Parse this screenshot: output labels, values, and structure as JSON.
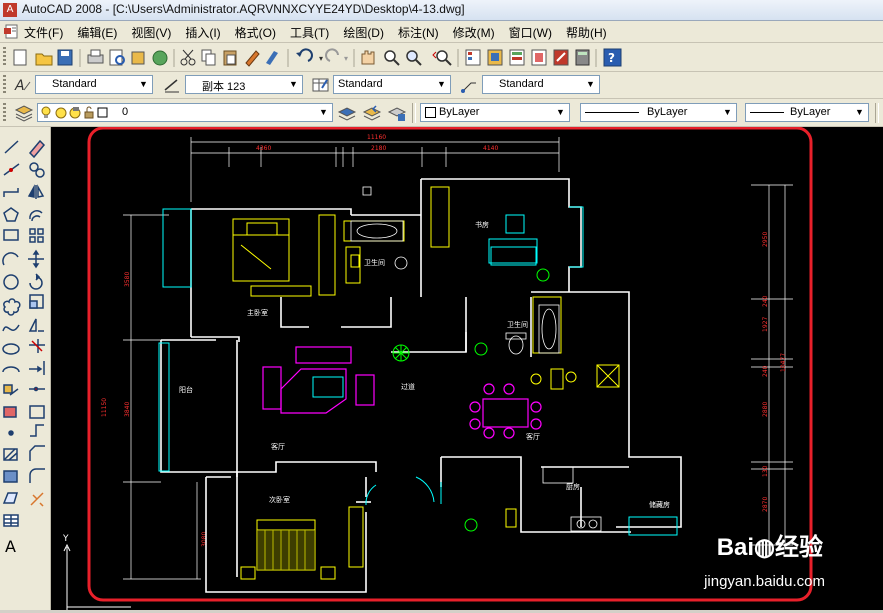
{
  "window": {
    "title": "AutoCAD 2008 - [C:\\Users\\Administrator.AQRVNNXCYYE24YD\\Desktop\\4-13.dwg]"
  },
  "menu": {
    "items": [
      "文件(F)",
      "编辑(E)",
      "视图(V)",
      "插入(I)",
      "格式(O)",
      "工具(T)",
      "绘图(D)",
      "标注(N)",
      "修改(M)",
      "窗口(W)",
      "帮助(H)"
    ]
  },
  "styles_toolbar": {
    "text_style": "Standard",
    "dim_style": "副本 123",
    "table_style": "Standard",
    "multileader_style": "Standard"
  },
  "layers_toolbar": {
    "current_layer": "0",
    "color": "ByLayer",
    "linetype": "ByLayer",
    "lineweight": "ByLayer"
  },
  "drawing": {
    "dims_top": {
      "overall": "11160",
      "segments": [
        "4360",
        "2180",
        "4140"
      ]
    },
    "dims_left": {
      "upper": "3580",
      "overall": "11150",
      "lower": "3840",
      "bottom": "3080"
    },
    "dims_right": {
      "top": "2950",
      "upper_mid": "1927",
      "mid_small": "240",
      "total": "10477",
      "lower_small": "240",
      "lower_mid": "2880",
      "lower_small2": "130",
      "bottom": "2870"
    },
    "rooms": {
      "study": "书房",
      "master_bedroom": "主卧室",
      "bathroom1": "卫生间",
      "bathroom2": "卫生间",
      "balcony": "阳台",
      "living_room": "客厅",
      "corridor": "过道",
      "dining": "客厅",
      "kitchen": "厨房",
      "storage": "储藏房",
      "second_bedroom": "次卧室"
    },
    "ucs_label": "Y"
  },
  "watermark": {
    "brand": "Bai",
    "brand_cn": "经验",
    "url": "jingyan.baidu.com"
  },
  "colors": {
    "wall": "#ffffff",
    "furniture_yellow": "#ffff00",
    "cyan": "#00ffff",
    "magenta": "#ff00ff",
    "green": "#00ff00",
    "dimension_red": "#ff0000",
    "highlight": "#e8202a"
  }
}
